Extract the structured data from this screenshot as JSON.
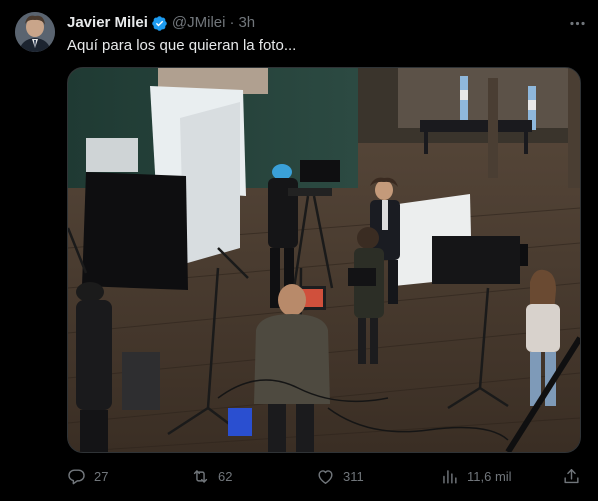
{
  "tweet": {
    "author_name": "Javier Milei",
    "handle": "@JMilei",
    "separator": "·",
    "time": "3h",
    "text": "Aquí para los que quieran la foto..."
  },
  "media": {
    "kind": "photo",
    "subject": "tv-studio-interview-setup"
  },
  "actions": {
    "replies": "27",
    "reposts": "62",
    "likes": "311",
    "views": "11,6 mil"
  },
  "colors": {
    "background": "#000000",
    "text_primary": "#e7e9ea",
    "text_secondary": "#71767b",
    "verified_blue": "#1d9bf0",
    "border": "#2f3336"
  },
  "icons": {
    "verified": "verified-badge-icon",
    "more": "more-horizontal-icon",
    "reply": "reply-bubble-icon",
    "repost": "repost-arrows-icon",
    "like": "heart-icon",
    "views": "bar-chart-icon",
    "share": "share-upload-icon"
  }
}
